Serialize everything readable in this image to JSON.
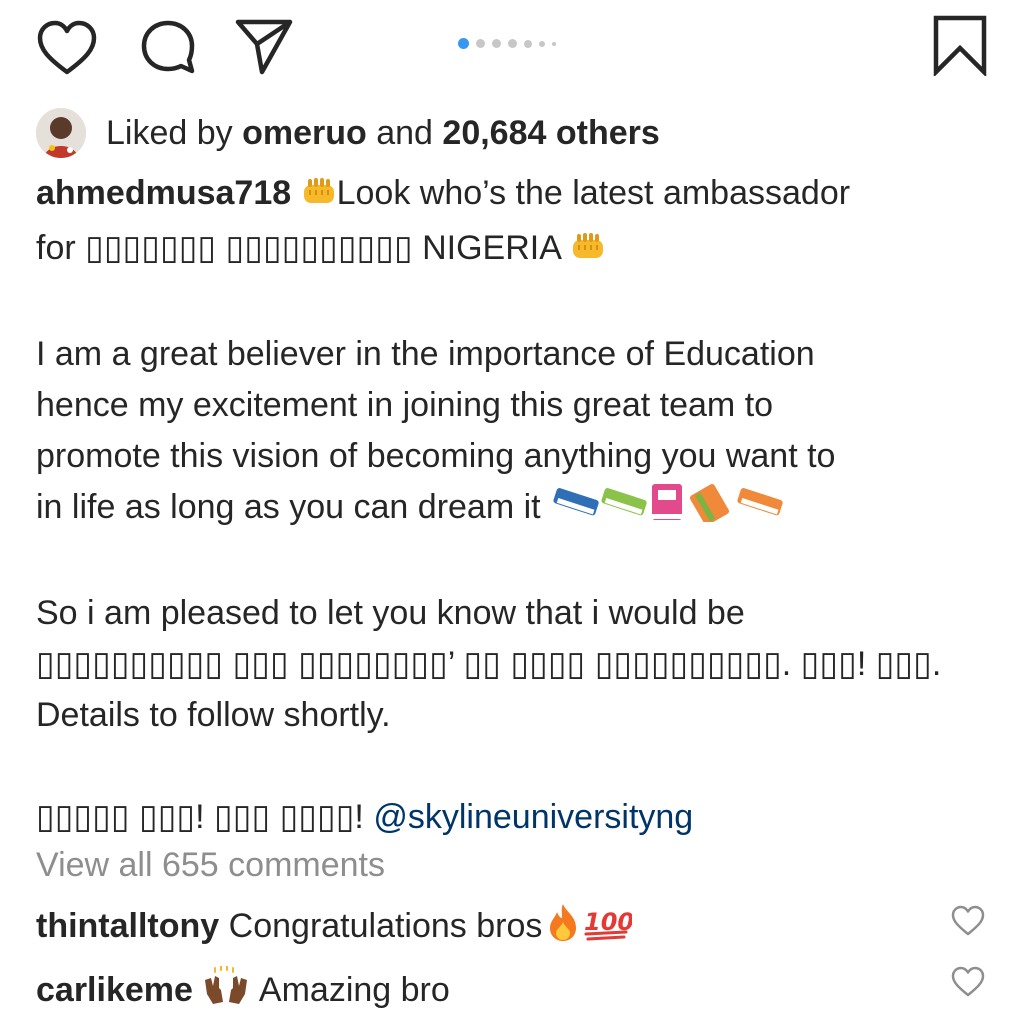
{
  "carousel": {
    "total": 7,
    "active_index": 0
  },
  "likes": {
    "prefix": "Liked by",
    "user": "omeruo",
    "and": "and",
    "count": "20,684 others"
  },
  "caption": {
    "username": "ahmedmusa718",
    "line1_text": "Look who’s the latest ambassador",
    "line2_prefix": "for",
    "line2_stylized": "▯▯▯▯▯▯▯ ▯▯▯▯▯▯▯▯▯▯",
    "line2_suffix": "NIGERIA",
    "paragraph2": [
      "I am a great believer in the importance of Education",
      "hence my excitement in joining this great team to",
      "promote this vision of becoming anything you want to",
      "in life as long as you can dream it"
    ],
    "paragraph3": [
      "So i am pleased to let you know that i would be",
      "▯▯▯▯▯▯▯▯▯▯ ▯▯▯ ▯▯▯▯▯▯▯▯’ ▯▯ ▯▯▯▯ ▯▯▯▯▯▯▯▯▯▯. ▯▯▯! ▯▯▯.",
      "Details to follow shortly."
    ],
    "closing_stylized": "▯▯▯▯▯ ▯▯▯! ▯▯▯ ▯▯▯▯!",
    "mention": "@skylineuniversityng"
  },
  "comments": {
    "view_all": "View all 655 comments",
    "items": [
      {
        "user": "thintalltony",
        "text": "Congratulations bros"
      },
      {
        "user": "carlikeme",
        "text": "Amazing bro"
      }
    ]
  },
  "colors": {
    "accent": "#3897f0",
    "mention": "#003569",
    "muted": "#8e8e8e",
    "text": "#262626"
  },
  "icons": [
    "heart-icon",
    "comment-icon",
    "share-icon",
    "bookmark-icon",
    "fist-emoji",
    "books-emoji",
    "fire-emoji",
    "hundred-emoji",
    "raised-hands-emoji"
  ]
}
